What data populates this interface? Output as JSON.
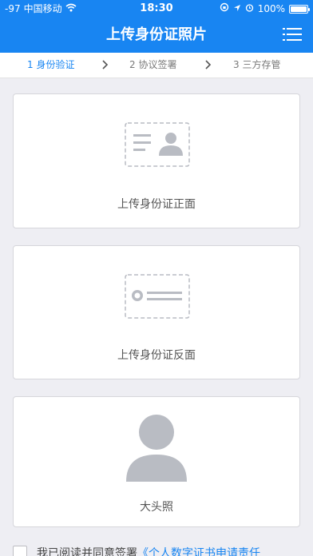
{
  "status_bar": {
    "signal": "-97",
    "carrier": "中国移动",
    "wifi_icon": "wifi-icon",
    "time": "18:30",
    "battery_percent": "100%",
    "battery_level": 1.0
  },
  "nav": {
    "title": "上传身份证照片",
    "menu_icon": "list-menu-icon"
  },
  "steps": [
    {
      "label": "1 身份验证",
      "active": true
    },
    {
      "label": "2 协议签署",
      "active": false
    },
    {
      "label": "3 三方存管",
      "active": false
    }
  ],
  "cards": {
    "front": {
      "label": "上传身份证正面",
      "icon": "id-card-front-icon"
    },
    "back": {
      "label": "上传身份证反面",
      "icon": "id-card-back-icon"
    },
    "portrait": {
      "label": "大头照",
      "icon": "avatar-silhouette-icon"
    }
  },
  "agreement": {
    "text": "我已阅读并同意签署",
    "link": "《个人数字证书申请责任"
  },
  "colors": {
    "accent": "#1885f2",
    "placeholder": "#b9bcc3"
  }
}
